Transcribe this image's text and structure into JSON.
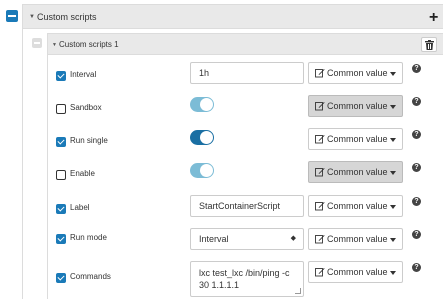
{
  "section": {
    "title": "Custom scripts"
  },
  "item": {
    "title": "Custom scripts 1"
  },
  "common_label": "Common value",
  "rows": {
    "interval": {
      "label": "Interval",
      "value": "1h",
      "checked": true
    },
    "sandbox": {
      "label": "Sandbox",
      "checked": false
    },
    "run_single": {
      "label": "Run single",
      "checked": true
    },
    "enable": {
      "label": "Enable",
      "checked": false
    },
    "label": {
      "label": "Label",
      "value": "StartContainerScript",
      "checked": true
    },
    "run_mode": {
      "label": "Run mode",
      "value": "Interval",
      "checked": true
    },
    "commands": {
      "label": "Commands",
      "value": "lxc test_lxc /bin/ping -c 30 1.1.1.1",
      "checked": true
    }
  },
  "colors": {
    "accent": "#1a7ab8",
    "switch_faded": "#7cbcd6",
    "switch_solid": "#1a6fa3"
  },
  "icons": [
    "collapse-icon",
    "plus-icon",
    "trash-icon",
    "edit-icon",
    "help-icon",
    "caret-down-icon"
  ]
}
